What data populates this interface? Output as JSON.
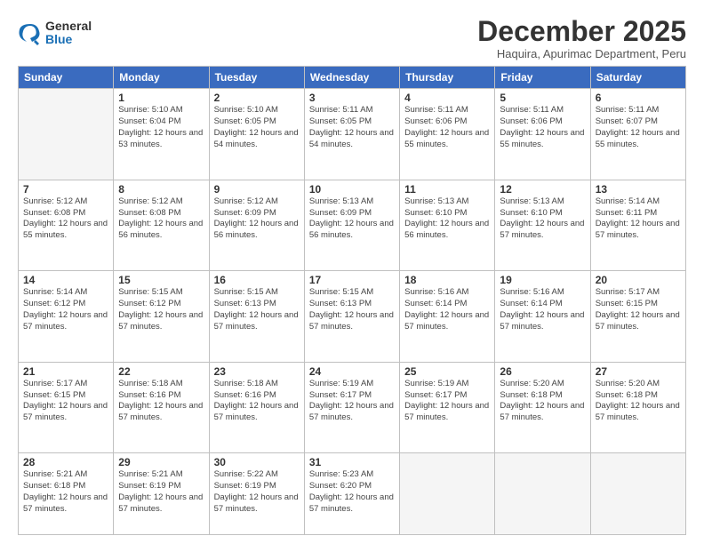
{
  "header": {
    "logo_general": "General",
    "logo_blue": "Blue",
    "title": "December 2025",
    "subtitle": "Haquira, Apurimac Department, Peru"
  },
  "weekdays": [
    "Sunday",
    "Monday",
    "Tuesday",
    "Wednesday",
    "Thursday",
    "Friday",
    "Saturday"
  ],
  "weeks": [
    [
      {
        "day": "",
        "sunrise": "",
        "sunset": "",
        "daylight": "",
        "empty": true
      },
      {
        "day": "1",
        "sunrise": "Sunrise: 5:10 AM",
        "sunset": "Sunset: 6:04 PM",
        "daylight": "Daylight: 12 hours and 53 minutes."
      },
      {
        "day": "2",
        "sunrise": "Sunrise: 5:10 AM",
        "sunset": "Sunset: 6:05 PM",
        "daylight": "Daylight: 12 hours and 54 minutes."
      },
      {
        "day": "3",
        "sunrise": "Sunrise: 5:11 AM",
        "sunset": "Sunset: 6:05 PM",
        "daylight": "Daylight: 12 hours and 54 minutes."
      },
      {
        "day": "4",
        "sunrise": "Sunrise: 5:11 AM",
        "sunset": "Sunset: 6:06 PM",
        "daylight": "Daylight: 12 hours and 55 minutes."
      },
      {
        "day": "5",
        "sunrise": "Sunrise: 5:11 AM",
        "sunset": "Sunset: 6:06 PM",
        "daylight": "Daylight: 12 hours and 55 minutes."
      },
      {
        "day": "6",
        "sunrise": "Sunrise: 5:11 AM",
        "sunset": "Sunset: 6:07 PM",
        "daylight": "Daylight: 12 hours and 55 minutes."
      }
    ],
    [
      {
        "day": "7",
        "sunrise": "Sunrise: 5:12 AM",
        "sunset": "Sunset: 6:08 PM",
        "daylight": "Daylight: 12 hours and 55 minutes."
      },
      {
        "day": "8",
        "sunrise": "Sunrise: 5:12 AM",
        "sunset": "Sunset: 6:08 PM",
        "daylight": "Daylight: 12 hours and 56 minutes."
      },
      {
        "day": "9",
        "sunrise": "Sunrise: 5:12 AM",
        "sunset": "Sunset: 6:09 PM",
        "daylight": "Daylight: 12 hours and 56 minutes."
      },
      {
        "day": "10",
        "sunrise": "Sunrise: 5:13 AM",
        "sunset": "Sunset: 6:09 PM",
        "daylight": "Daylight: 12 hours and 56 minutes."
      },
      {
        "day": "11",
        "sunrise": "Sunrise: 5:13 AM",
        "sunset": "Sunset: 6:10 PM",
        "daylight": "Daylight: 12 hours and 56 minutes."
      },
      {
        "day": "12",
        "sunrise": "Sunrise: 5:13 AM",
        "sunset": "Sunset: 6:10 PM",
        "daylight": "Daylight: 12 hours and 57 minutes."
      },
      {
        "day": "13",
        "sunrise": "Sunrise: 5:14 AM",
        "sunset": "Sunset: 6:11 PM",
        "daylight": "Daylight: 12 hours and 57 minutes."
      }
    ],
    [
      {
        "day": "14",
        "sunrise": "Sunrise: 5:14 AM",
        "sunset": "Sunset: 6:12 PM",
        "daylight": "Daylight: 12 hours and 57 minutes."
      },
      {
        "day": "15",
        "sunrise": "Sunrise: 5:15 AM",
        "sunset": "Sunset: 6:12 PM",
        "daylight": "Daylight: 12 hours and 57 minutes."
      },
      {
        "day": "16",
        "sunrise": "Sunrise: 5:15 AM",
        "sunset": "Sunset: 6:13 PM",
        "daylight": "Daylight: 12 hours and 57 minutes."
      },
      {
        "day": "17",
        "sunrise": "Sunrise: 5:15 AM",
        "sunset": "Sunset: 6:13 PM",
        "daylight": "Daylight: 12 hours and 57 minutes."
      },
      {
        "day": "18",
        "sunrise": "Sunrise: 5:16 AM",
        "sunset": "Sunset: 6:14 PM",
        "daylight": "Daylight: 12 hours and 57 minutes."
      },
      {
        "day": "19",
        "sunrise": "Sunrise: 5:16 AM",
        "sunset": "Sunset: 6:14 PM",
        "daylight": "Daylight: 12 hours and 57 minutes."
      },
      {
        "day": "20",
        "sunrise": "Sunrise: 5:17 AM",
        "sunset": "Sunset: 6:15 PM",
        "daylight": "Daylight: 12 hours and 57 minutes."
      }
    ],
    [
      {
        "day": "21",
        "sunrise": "Sunrise: 5:17 AM",
        "sunset": "Sunset: 6:15 PM",
        "daylight": "Daylight: 12 hours and 57 minutes."
      },
      {
        "day": "22",
        "sunrise": "Sunrise: 5:18 AM",
        "sunset": "Sunset: 6:16 PM",
        "daylight": "Daylight: 12 hours and 57 minutes."
      },
      {
        "day": "23",
        "sunrise": "Sunrise: 5:18 AM",
        "sunset": "Sunset: 6:16 PM",
        "daylight": "Daylight: 12 hours and 57 minutes."
      },
      {
        "day": "24",
        "sunrise": "Sunrise: 5:19 AM",
        "sunset": "Sunset: 6:17 PM",
        "daylight": "Daylight: 12 hours and 57 minutes."
      },
      {
        "day": "25",
        "sunrise": "Sunrise: 5:19 AM",
        "sunset": "Sunset: 6:17 PM",
        "daylight": "Daylight: 12 hours and 57 minutes."
      },
      {
        "day": "26",
        "sunrise": "Sunrise: 5:20 AM",
        "sunset": "Sunset: 6:18 PM",
        "daylight": "Daylight: 12 hours and 57 minutes."
      },
      {
        "day": "27",
        "sunrise": "Sunrise: 5:20 AM",
        "sunset": "Sunset: 6:18 PM",
        "daylight": "Daylight: 12 hours and 57 minutes."
      }
    ],
    [
      {
        "day": "28",
        "sunrise": "Sunrise: 5:21 AM",
        "sunset": "Sunset: 6:18 PM",
        "daylight": "Daylight: 12 hours and 57 minutes."
      },
      {
        "day": "29",
        "sunrise": "Sunrise: 5:21 AM",
        "sunset": "Sunset: 6:19 PM",
        "daylight": "Daylight: 12 hours and 57 minutes."
      },
      {
        "day": "30",
        "sunrise": "Sunrise: 5:22 AM",
        "sunset": "Sunset: 6:19 PM",
        "daylight": "Daylight: 12 hours and 57 minutes."
      },
      {
        "day": "31",
        "sunrise": "Sunrise: 5:23 AM",
        "sunset": "Sunset: 6:20 PM",
        "daylight": "Daylight: 12 hours and 57 minutes."
      },
      {
        "day": "",
        "sunrise": "",
        "sunset": "",
        "daylight": "",
        "empty": true
      },
      {
        "day": "",
        "sunrise": "",
        "sunset": "",
        "daylight": "",
        "empty": true
      },
      {
        "day": "",
        "sunrise": "",
        "sunset": "",
        "daylight": "",
        "empty": true
      }
    ]
  ]
}
